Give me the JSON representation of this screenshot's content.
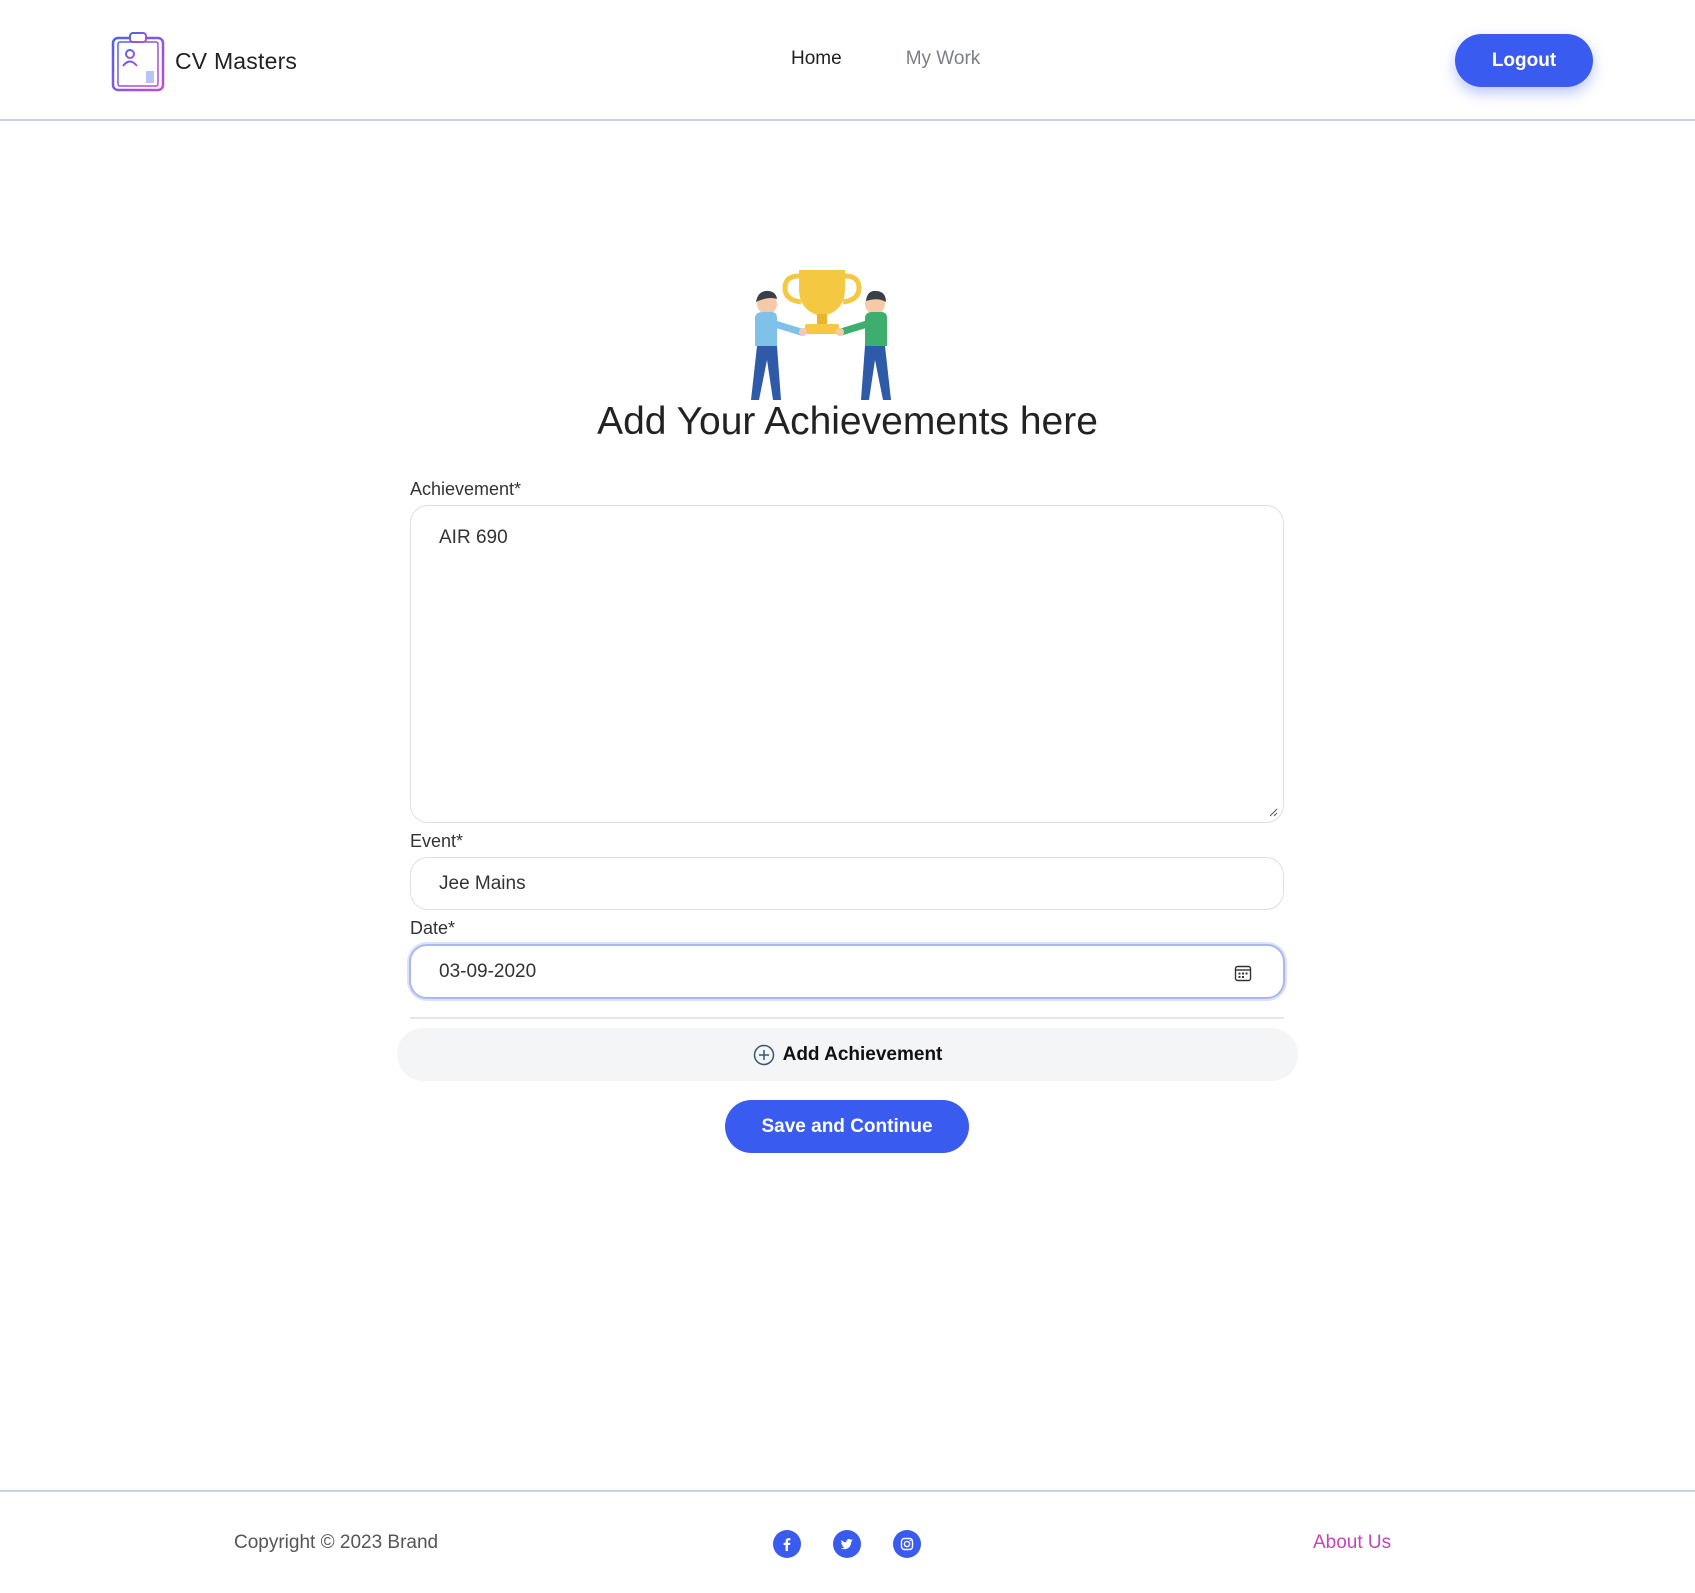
{
  "header": {
    "brand_name": "CV Masters",
    "nav": [
      {
        "label": "Home",
        "active": true
      },
      {
        "label": "My Work",
        "active": false
      }
    ],
    "logout_label": "Logout"
  },
  "main": {
    "title": "Add Your Achievements here",
    "form": {
      "achievement": {
        "label": "Achievement*",
        "value": "AIR 690"
      },
      "event": {
        "label": "Event*",
        "value": "Jee Mains"
      },
      "date": {
        "label": "Date*",
        "value": "03-09-2020"
      }
    },
    "add_button_label": "Add Achievement",
    "save_button_label": "Save and Continue"
  },
  "footer": {
    "copyright": "Copyright © 2023 Brand",
    "social_icons": [
      "facebook-icon",
      "twitter-icon",
      "instagram-icon"
    ],
    "about_label": "About Us"
  },
  "colors": {
    "primary": "#3a5bef",
    "about_link": "#c246b8",
    "header_border": "#c9d2e3"
  }
}
